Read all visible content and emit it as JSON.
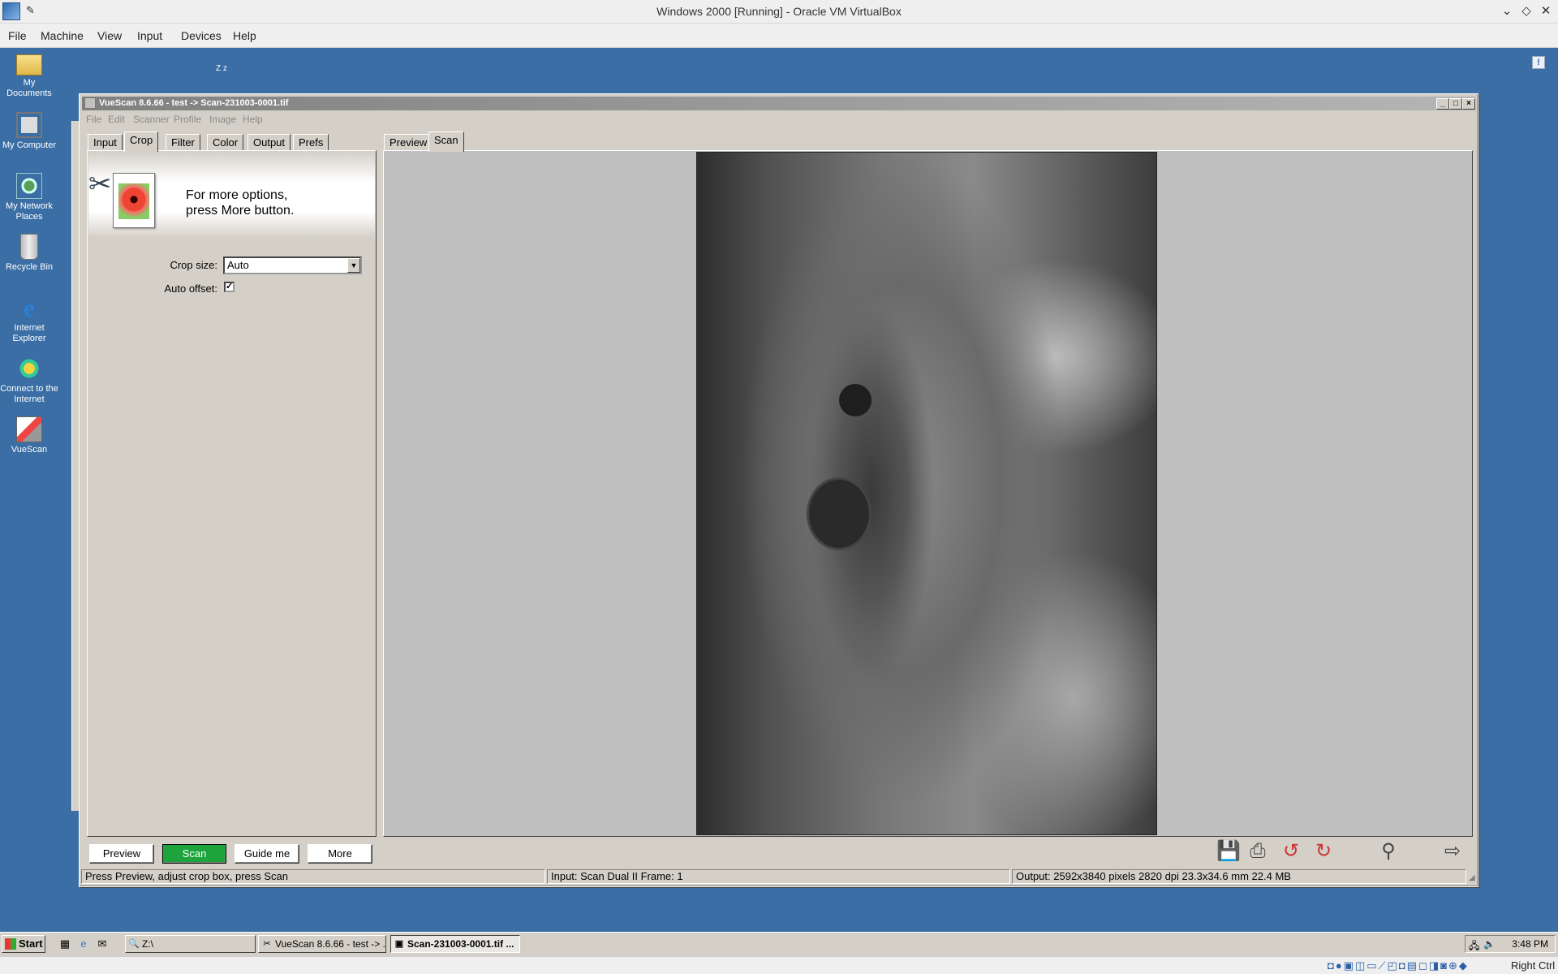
{
  "host": {
    "title": "Windows 2000 [Running] - Oracle VM VirtualBox",
    "menu": [
      "File",
      "Machine",
      "View",
      "Input",
      "Devices",
      "Help"
    ],
    "host_key": "Right Ctrl",
    "status_icons": "◘●▣◫▭⟋◰◘▤◻◨◙⊕◆"
  },
  "desktop": {
    "icons": [
      {
        "label": "My Documents",
        "icon": "folder-icon"
      },
      {
        "label": "My Computer",
        "icon": "computer-icon"
      },
      {
        "label": "My Network Places",
        "icon": "network-icon"
      },
      {
        "label": "Recycle Bin",
        "icon": "recycle-bin-icon"
      },
      {
        "label": "Internet Explorer",
        "icon": "ie-icon"
      },
      {
        "label": "Connect to the Internet",
        "icon": "connect-icon"
      },
      {
        "label": "VueScan",
        "icon": "vuescan-icon"
      }
    ],
    "sleep_label": "Z z"
  },
  "vuescan": {
    "title": "VueScan 8.6.66 - test -> Scan-231003-0001.tif",
    "menu": [
      "File",
      "Edit",
      "Scanner",
      "Profile",
      "Image",
      "Help"
    ],
    "left_tabs": [
      "Input",
      "Crop",
      "Filter",
      "Color",
      "Output",
      "Prefs"
    ],
    "active_left_tab": "Crop",
    "right_tabs": [
      "Preview",
      "Scan"
    ],
    "active_right_tab": "Scan",
    "banner_line1": "For more options,",
    "banner_line2": "press More button.",
    "crop_size_label": "Crop size:",
    "crop_size_value": "Auto",
    "auto_offset_label": "Auto offset:",
    "auto_offset_checked": true,
    "buttons": {
      "preview": "Preview",
      "scan": "Scan",
      "guide": "Guide me",
      "more": "More"
    },
    "status": {
      "left": "Press Preview, adjust crop box, press Scan",
      "mid": "Input: Scan Dual II Frame: 1",
      "right": "Output: 2592x3840 pixels 2820 dpi 23.3x34.6 mm 22.4 MB"
    },
    "accent_green": "#1ea43c"
  },
  "taskbar": {
    "start": "Start",
    "tasks": [
      "Z:\\",
      "VueScan 8.6.66 - test -> ...",
      "Scan-231003-0001.tif ..."
    ],
    "clock": "3:48 PM"
  }
}
